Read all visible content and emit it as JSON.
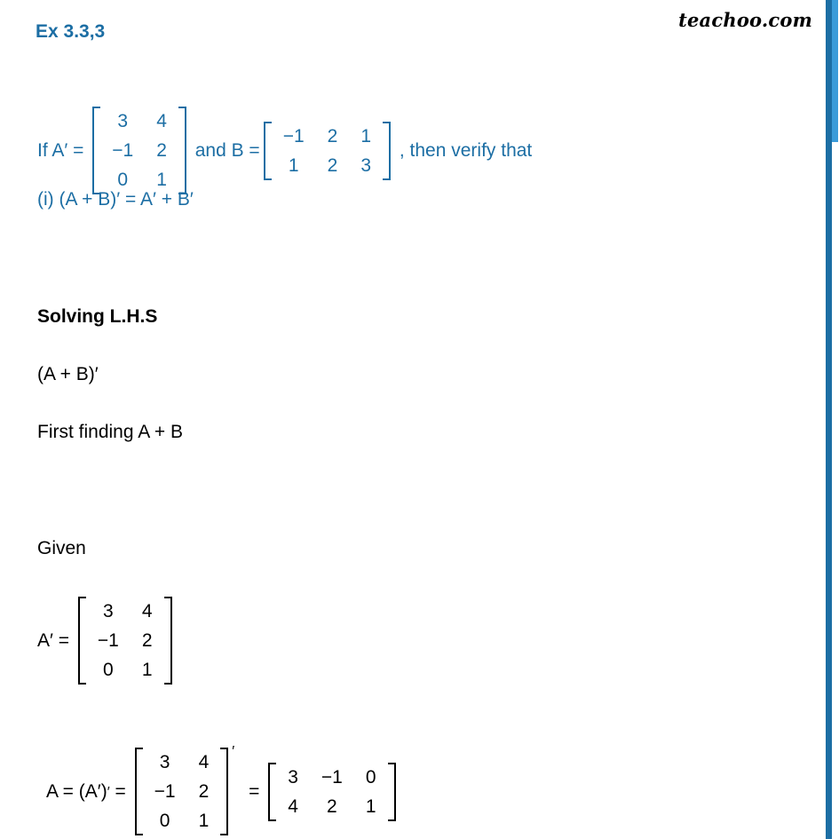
{
  "watermark": "teachoo.com",
  "header": {
    "exercise_title": "Ex 3.3,3"
  },
  "colors": {
    "accent_blue": "#1c6ea4",
    "edge_light_blue": "#3a9bd9",
    "text_black": "#000000"
  },
  "question": {
    "prefix": "If A′ = ",
    "matrix_A_transpose": [
      [
        "3",
        "4"
      ],
      [
        "−1",
        "2"
      ],
      [
        "0",
        "1"
      ]
    ],
    "middle": " and B =",
    "matrix_B": [
      [
        "−1",
        "2",
        "1"
      ],
      [
        "1",
        "2",
        "3"
      ]
    ],
    "suffix": " , then verify that",
    "part_i": "(i) (A + B)′ = A′ + B′"
  },
  "body": {
    "solving_lhs": "Solving L.H.S",
    "expression_ab": "(A + B)′",
    "first_finding": "First finding A + B",
    "given": "Given",
    "given_label": "A′ = ",
    "given_matrix": [
      [
        "3",
        "4"
      ],
      [
        "−1",
        "2"
      ],
      [
        "0",
        "1"
      ]
    ],
    "derivation_label": "A = (A′)",
    "derivation_prime": "′",
    "derivation_equals_1": " = ",
    "derivation_matrix": [
      [
        "3",
        "4"
      ],
      [
        "−1",
        "2"
      ],
      [
        "0",
        "1"
      ]
    ],
    "derivation_matrix_prime": "′",
    "derivation_equals_2": " = ",
    "result_matrix": [
      [
        "3",
        "−1",
        "0"
      ],
      [
        "4",
        "2",
        "1"
      ]
    ]
  }
}
